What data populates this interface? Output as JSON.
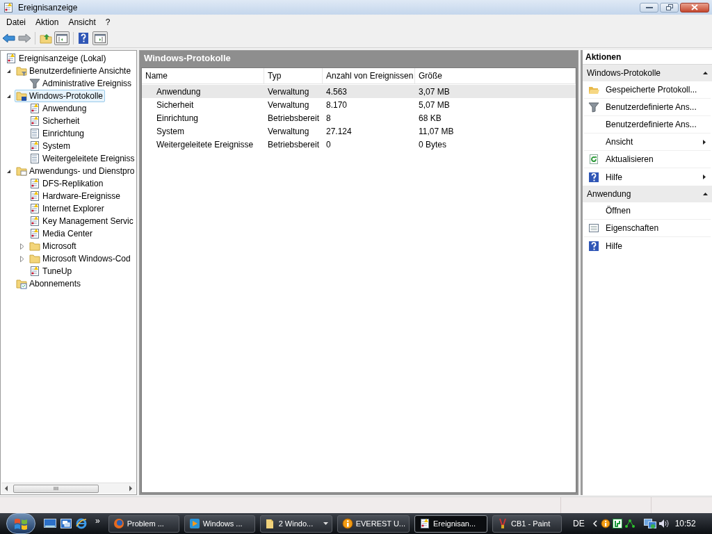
{
  "window": {
    "title": "Ereignisanzeige"
  },
  "menu": [
    "Datei",
    "Aktion",
    "Ansicht",
    "?"
  ],
  "tree": [
    {
      "label": "Ereignisanzeige (Lokal)",
      "kind": "root",
      "selected": false,
      "children": [
        {
          "label": "Benutzerdefinierte Ansichte",
          "kind": "folder-filter",
          "selected": false,
          "expanded": true,
          "children": [
            {
              "label": "Administrative Ereigniss",
              "kind": "filter",
              "selected": false
            }
          ]
        },
        {
          "label": "Windows-Protokolle",
          "kind": "folder-logs",
          "selected": true,
          "expanded": true,
          "children": [
            {
              "label": "Anwendung",
              "kind": "log",
              "selected": false
            },
            {
              "label": "Sicherheit",
              "kind": "log",
              "selected": false
            },
            {
              "label": "Einrichtung",
              "kind": "sheet",
              "selected": false
            },
            {
              "label": "System",
              "kind": "log",
              "selected": false
            },
            {
              "label": "Weitergeleitete Ereigniss",
              "kind": "sheet",
              "selected": false
            }
          ]
        },
        {
          "label": "Anwendungs- und Dienstpro",
          "kind": "folder-apps",
          "selected": false,
          "expanded": true,
          "children": [
            {
              "label": "DFS-Replikation",
              "kind": "log",
              "selected": false
            },
            {
              "label": "Hardware-Ereignisse",
              "kind": "log",
              "selected": false
            },
            {
              "label": "Internet Explorer",
              "kind": "log",
              "selected": false
            },
            {
              "label": "Key Management Servic",
              "kind": "log",
              "selected": false
            },
            {
              "label": "Media Center",
              "kind": "log",
              "selected": false
            },
            {
              "label": "Microsoft",
              "kind": "folder",
              "selected": false,
              "expanded": false
            },
            {
              "label": "Microsoft Windows-Cod",
              "kind": "folder",
              "selected": false,
              "expanded": false
            },
            {
              "label": "TuneUp",
              "kind": "log",
              "selected": false
            }
          ]
        },
        {
          "label": "Abonnements",
          "kind": "folder-subs",
          "selected": false
        }
      ]
    }
  ],
  "main": {
    "title": "Windows-Protokolle",
    "columns": [
      "Name",
      "Typ",
      "Anzahl von Ereignissen",
      "Größe"
    ],
    "rows": [
      {
        "cells": [
          "Anwendung",
          "Verwaltung",
          "4.563",
          "3,07 MB"
        ],
        "selected": true
      },
      {
        "cells": [
          "Sicherheit",
          "Verwaltung",
          "8.170",
          "5,07 MB"
        ],
        "selected": false
      },
      {
        "cells": [
          "Einrichtung",
          "Betriebsbereit",
          "8",
          "68 KB"
        ],
        "selected": false
      },
      {
        "cells": [
          "System",
          "Verwaltung",
          "27.124",
          "11,07 MB"
        ],
        "selected": false
      },
      {
        "cells": [
          "Weitergeleitete Ereignisse",
          "Betriebsbereit",
          "0",
          "0 Bytes"
        ],
        "selected": false
      }
    ]
  },
  "actions": {
    "title": "Aktionen",
    "sections": [
      {
        "title": "Windows-Protokolle",
        "expanded": true,
        "items": [
          {
            "label": "Gespeicherte Protokoll...",
            "kind": "open-folder",
            "submenu": false
          },
          {
            "label": "Benutzerdefinierte Ans...",
            "kind": "filter",
            "submenu": false
          },
          {
            "label": "Benutzerdefinierte Ans...",
            "kind": "plain",
            "submenu": false
          },
          {
            "label": "Ansicht",
            "kind": "plain",
            "submenu": true
          },
          {
            "label": "Aktualisieren",
            "kind": "refresh",
            "submenu": false
          },
          {
            "label": "Hilfe",
            "kind": "help",
            "submenu": true
          }
        ]
      },
      {
        "title": "Anwendung",
        "expanded": true,
        "items": [
          {
            "label": "Öffnen",
            "kind": "plain",
            "submenu": false
          },
          {
            "label": "Eigenschaften",
            "kind": "properties",
            "submenu": false
          },
          {
            "label": "Hilfe",
            "kind": "help",
            "submenu": false
          }
        ]
      }
    ]
  },
  "taskbar": {
    "more": "»",
    "buttons": [
      {
        "label": "Problem ...",
        "kind": "firefox",
        "selected": false,
        "group": false
      },
      {
        "label": "Windows ...",
        "kind": "media",
        "selected": false,
        "group": false
      },
      {
        "label": "2 Windo...",
        "kind": "folder",
        "selected": false,
        "group": true
      },
      {
        "label": "EVEREST U...",
        "kind": "info",
        "selected": false,
        "group": false
      },
      {
        "label": "Ereignisan...",
        "kind": "log",
        "selected": true,
        "group": false
      },
      {
        "label": "CB1 - Paint",
        "kind": "paint",
        "selected": false,
        "group": false
      }
    ],
    "language": "DE",
    "clock": "10:52"
  }
}
